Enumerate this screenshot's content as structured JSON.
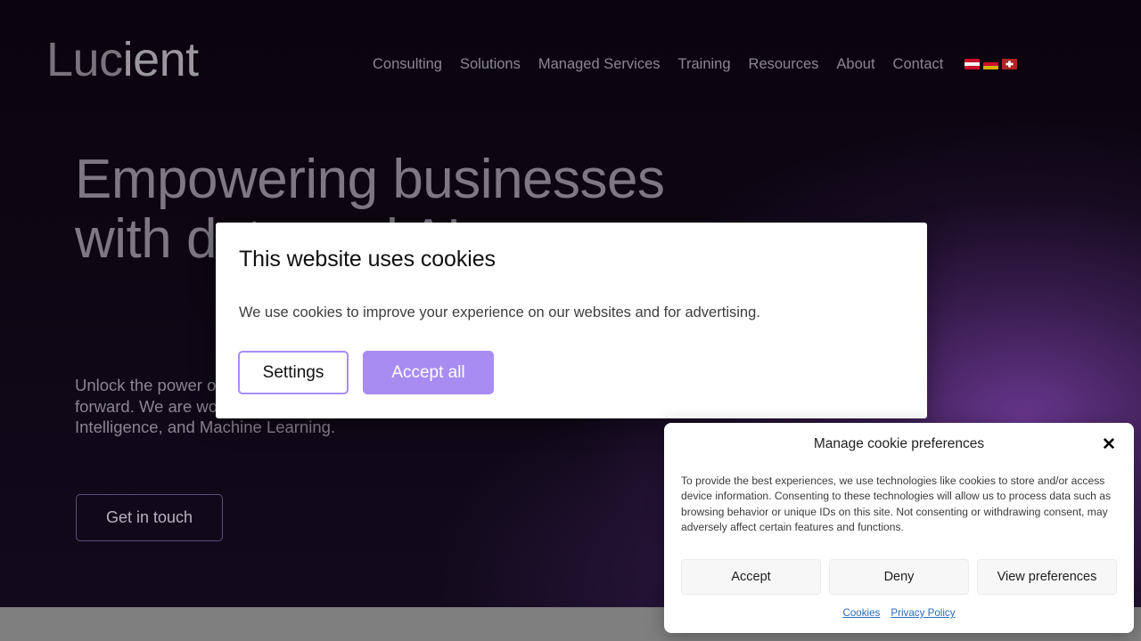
{
  "site": {
    "logo_light": "Luc",
    "logo_bold": "ient"
  },
  "nav": {
    "items": [
      {
        "label": "Consulting"
      },
      {
        "label": "Solutions"
      },
      {
        "label": "Managed Services"
      },
      {
        "label": "Training"
      },
      {
        "label": "Resources"
      },
      {
        "label": "About"
      },
      {
        "label": "Contact"
      }
    ],
    "flags": [
      {
        "name": "flag-austria",
        "title": "Austria",
        "colors": [
          "#c8102e",
          "#f0f0f0",
          "#c8102e"
        ]
      },
      {
        "name": "flag-germany",
        "title": "Germany",
        "colors": [
          "#0a0a0a",
          "#c8102e",
          "#d8b000"
        ]
      },
      {
        "name": "flag-switzerland",
        "title": "Switzerland",
        "colors": [
          "#b32222",
          "#ffffff"
        ]
      }
    ]
  },
  "hero": {
    "title": "Empowering businesses with data and AI",
    "subtitle": "Unlock the power of your data with Lucient and bring your business forward. We are world-class experts in Data Management, Business Intelligence, and Machine Learning.",
    "cta_label": "Get in touch"
  },
  "cookie_modal": {
    "title": "This website uses cookies",
    "body": "We use cookies to improve your experience on our websites and for advertising.",
    "settings_label": "Settings",
    "accept_all_label": "Accept all",
    "accent_color": "#a88cf2"
  },
  "preferences_panel": {
    "title": "Manage cookie preferences",
    "close_label": "✕",
    "body": "To provide the best experiences, we use technologies like cookies to store and/or access device information. Consenting to these technologies will allow us to process data such as browsing behavior or unique IDs on this site. Not consenting or withdrawing consent, may adversely affect certain features and functions.",
    "buttons": [
      {
        "label": "Accept"
      },
      {
        "label": "Deny"
      },
      {
        "label": "View preferences"
      }
    ],
    "links": [
      {
        "label": "Cookies"
      },
      {
        "label": "Privacy Policy"
      }
    ],
    "link_color": "#2b6cb9"
  },
  "theme": {
    "background": "#0d0613",
    "glow": "#763ea0",
    "bottom_band": "#7f7f7f",
    "muted_text": "#8b8492"
  }
}
